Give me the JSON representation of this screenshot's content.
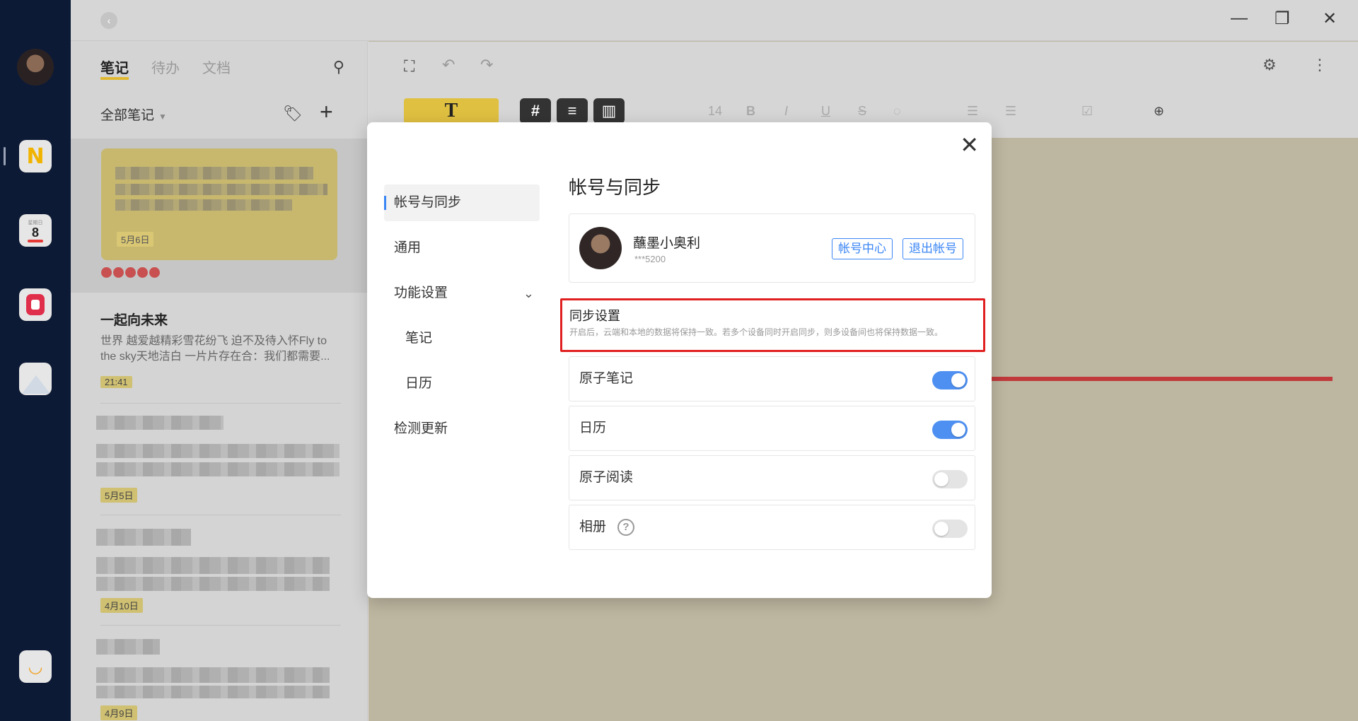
{
  "list": {
    "tabs": [
      "笔记",
      "待办",
      "文档"
    ],
    "folder": "全部笔记",
    "notes": [
      {
        "date": "5月6日"
      },
      {
        "title": "一起向未来",
        "body": "世界 越爱越精彩雪花纷飞 迫不及待入怀Fly to the sky天地洁白 一片片存在合：我们都需要...",
        "date": "21:41"
      },
      {
        "date": "5月5日"
      },
      {
        "date": "4月10日"
      },
      {
        "date": "4月9日"
      }
    ]
  },
  "dock": {
    "cal_day": "8",
    "cal_top": "星期日"
  },
  "toolbar": {
    "font_size": "14",
    "t_label": "T"
  },
  "modal": {
    "nav": {
      "account_sync": "帐号与同步",
      "general": "通用",
      "features": "功能设置",
      "notes": "笔记",
      "calendar": "日历",
      "check_update": "检测更新"
    },
    "title": "帐号与同步",
    "account": {
      "username": "蘸墨小奥利",
      "uid": "***5200",
      "center_button": "帐号中心",
      "logout_button": "退出帐号"
    },
    "sync": {
      "title": "同步设置",
      "desc": "开启后，云端和本地的数据将保持一致。若多个设备同时开启同步，则多设备间也将保持数据一致。",
      "items": [
        {
          "label": "原子笔记",
          "on": true
        },
        {
          "label": "日历",
          "on": true
        },
        {
          "label": "原子阅读",
          "on": false
        },
        {
          "label": "相册",
          "on": false
        }
      ]
    }
  },
  "colors": {
    "accent": "#3b86f5",
    "highlight_border": "#e02020",
    "toggle_on": "#4e90f2"
  }
}
